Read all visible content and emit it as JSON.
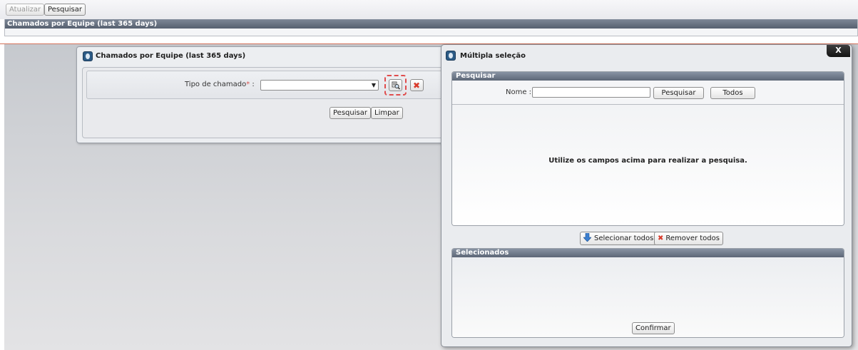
{
  "toolbar": {
    "refresh_label": "Atualizar",
    "search_label": "Pesquisar"
  },
  "report_title": "Chamados por Equipe (last 365 days)",
  "filter_panel": {
    "title": "Chamados por Equipe (last 365 days)",
    "field_label": "Tipo de chamado",
    "required_mark": "*",
    "field_colon": ":",
    "select_value": "",
    "search_button": "Pesquisar",
    "clear_button": "Limpar"
  },
  "dialog": {
    "title": "Múltipla seleção",
    "close_label": "X",
    "search_section": {
      "header": "Pesquisar",
      "name_label": "Nome :",
      "name_value": "",
      "search_button": "Pesquisar",
      "all_button": "Todos",
      "empty_message": "Utilize os campos acima para realizar a pesquisa."
    },
    "select_all_button": "Selecionar todos",
    "remove_all_button": "Remover todos",
    "selected_section": {
      "header": "Selecionados"
    },
    "confirm_button": "Confirmar"
  },
  "colors": {
    "accent_red": "#d93a2b",
    "header_gradient": "#5d6777"
  }
}
